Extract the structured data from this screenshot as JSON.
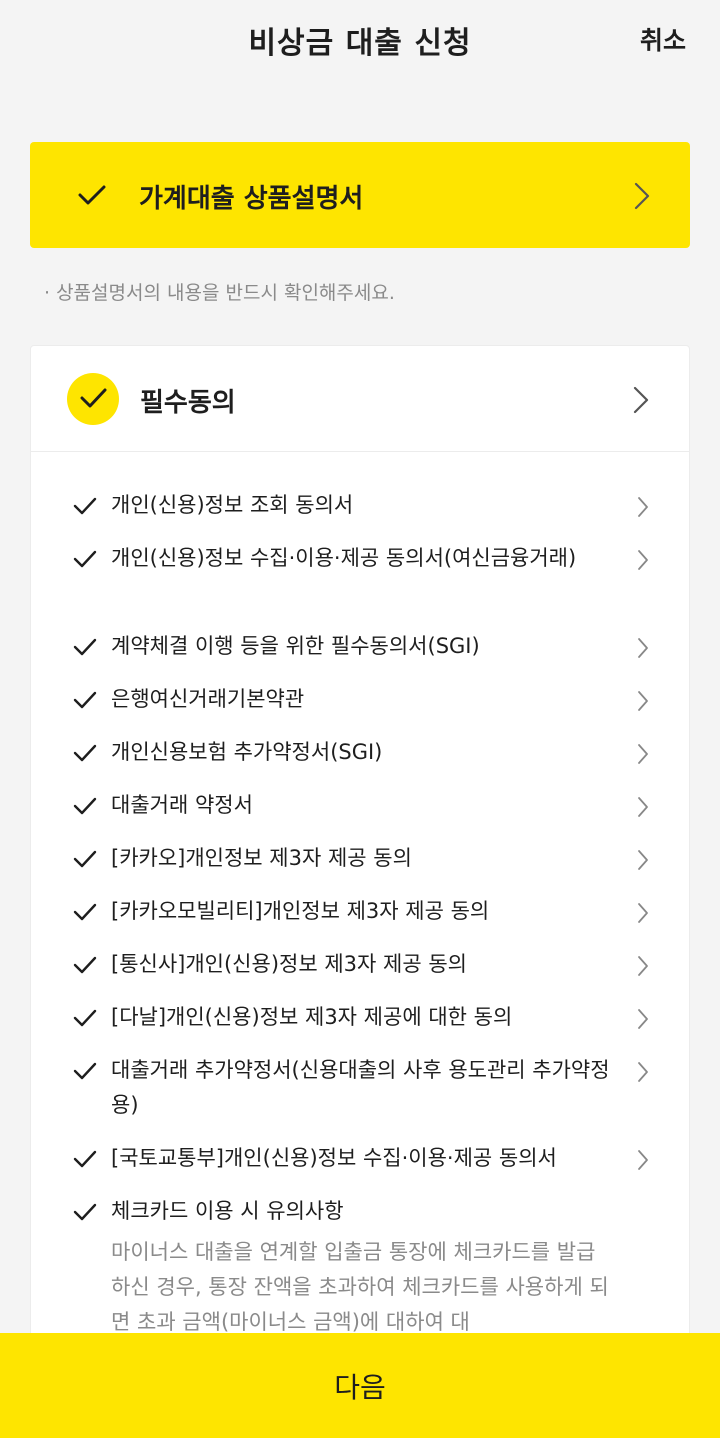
{
  "header": {
    "title": "비상금 대출 신청",
    "cancel_label": "취소"
  },
  "product": {
    "label": "가계대출 상품설명서"
  },
  "note": "· 상품설명서의 내용을 반드시 확인해주세요.",
  "agreement": {
    "title": "필수동의",
    "items": [
      {
        "label": "개인(신용)정보 조회 동의서"
      },
      {
        "label": "개인(신용)정보 수집·이용·제공 동의서(여신금융거래)"
      },
      {
        "label": "계약체결 이행 등을 위한 필수동의서(SGI)"
      },
      {
        "label": "은행여신거래기본약관"
      },
      {
        "label": "개인신용보험 추가약정서(SGI)"
      },
      {
        "label": "대출거래 약정서"
      },
      {
        "label": "[카카오]개인정보 제3자 제공 동의"
      },
      {
        "label": "[카카오모빌리티]개인정보 제3자 제공 동의"
      },
      {
        "label": "[통신사]개인(신용)정보 제3자 제공 동의"
      },
      {
        "label": "[다날]개인(신용)정보 제3자 제공에 대한 동의"
      },
      {
        "label": "대출거래 추가약정서(신용대출의 사후 용도관리 추가약정용)"
      },
      {
        "label": "[국토교통부]개인(신용)정보 수집·이용·제공 동의서"
      },
      {
        "label": "체크카드 이용 시 유의사항"
      }
    ],
    "checkcard_notice": "마이너스 대출을 연계할 입출금 통장에 체크카드를 발급하신 경우, 통장 잔액을 초과하여 체크카드를 사용하게 되면 초과 금액(마이너스 금액)에 대하여 대"
  },
  "next_button": {
    "label": "다음"
  },
  "colors": {
    "accent": "#fee500",
    "background": "#f4f4f4",
    "muted_text": "#8a8a8a"
  }
}
